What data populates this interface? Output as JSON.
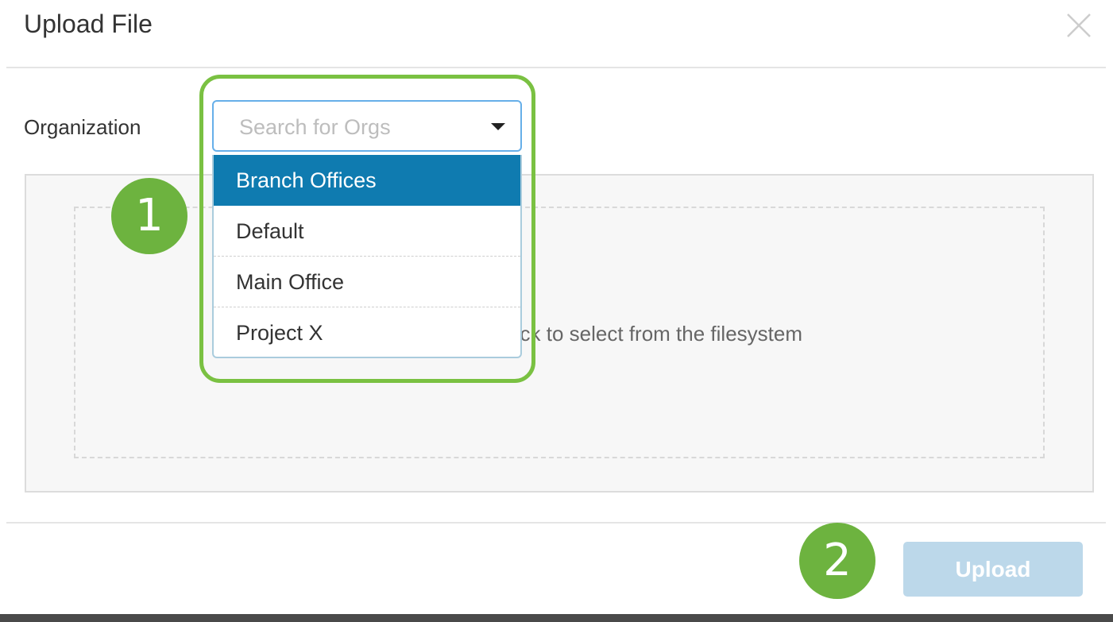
{
  "dialog": {
    "title": "Upload File",
    "close_icon": "close-icon"
  },
  "organization": {
    "label": "Organization",
    "placeholder": "Search for Orgs",
    "options": [
      {
        "label": "Branch Offices",
        "selected": true
      },
      {
        "label": "Default",
        "selected": false
      },
      {
        "label": "Main Office",
        "selected": false
      },
      {
        "label": "Project X",
        "selected": false
      }
    ]
  },
  "dropzone": {
    "text": "click to select from the filesystem"
  },
  "footer": {
    "upload_label": "Upload"
  },
  "annotations": {
    "step1": "1",
    "step2": "2"
  },
  "colors": {
    "highlight": "#7ac142",
    "badge": "#6db33f",
    "selected_option": "#0f7bb0",
    "upload_disabled": "#bcd8ea"
  }
}
